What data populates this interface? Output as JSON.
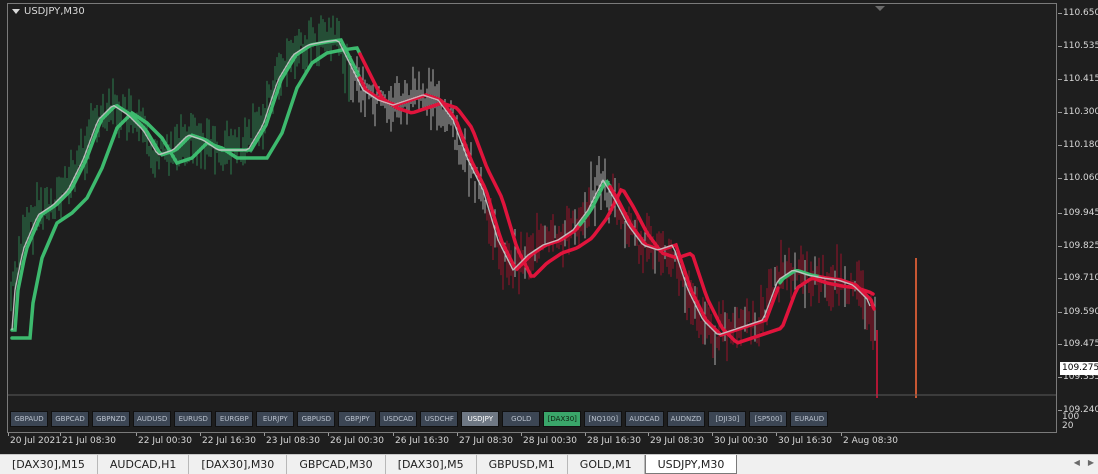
{
  "chart": {
    "title": "USDJPY,M30",
    "price_labels": [
      "110.650",
      "110.535",
      "110.415",
      "110.300",
      "110.180",
      "110.060",
      "109.945",
      "109.825",
      "109.710",
      "109.590",
      "109.475",
      "109.355",
      "109.240"
    ],
    "current_price": "109.275",
    "subwindow_labels": [
      "100",
      "20"
    ],
    "time_labels": [
      "20 Jul 2021",
      "21 Jul 08:30",
      "22 Jul 00:30",
      "22 Jul 16:30",
      "23 Jul 08:30",
      "26 Jul 00:30",
      "26 Jul 16:30",
      "27 Jul 08:30",
      "28 Jul 00:30",
      "28 Jul 16:30",
      "29 Jul 08:30",
      "30 Jul 00:30",
      "30 Jul 16:30",
      "2 Aug 08:30"
    ],
    "colors": {
      "bull": "#3dba6e",
      "bear": "#e0143c",
      "neutral": "#c8c8c8",
      "bg": "#1e1e1e",
      "spike": "#ff6a3a"
    }
  },
  "symbol_buttons": [
    {
      "label": "GBPAUD",
      "state": ""
    },
    {
      "label": "GBPCAD",
      "state": ""
    },
    {
      "label": "GBPNZD",
      "state": ""
    },
    {
      "label": "AUDUSD",
      "state": ""
    },
    {
      "label": "EURUSD",
      "state": ""
    },
    {
      "label": "EURGBP",
      "state": ""
    },
    {
      "label": "EURJPY",
      "state": ""
    },
    {
      "label": "GBPUSD",
      "state": ""
    },
    {
      "label": "GBPJPY",
      "state": ""
    },
    {
      "label": "USDCAD",
      "state": ""
    },
    {
      "label": "USDCHF",
      "state": ""
    },
    {
      "label": "USDJPY",
      "state": "active"
    },
    {
      "label": "GOLD",
      "state": ""
    },
    {
      "label": "[DAX30]",
      "state": "hl"
    },
    {
      "label": "[NQ100]",
      "state": ""
    },
    {
      "label": "AUDCAD",
      "state": ""
    },
    {
      "label": "AUDNZD",
      "state": ""
    },
    {
      "label": "[DJI30]",
      "state": ""
    },
    {
      "label": "[SP500]",
      "state": ""
    },
    {
      "label": "EURAUD",
      "state": ""
    }
  ],
  "tabs": [
    {
      "label": "[DAX30],M15",
      "active": false
    },
    {
      "label": "AUDCAD,H1",
      "active": false
    },
    {
      "label": "[DAX30],M30",
      "active": false
    },
    {
      "label": "GBPCAD,M30",
      "active": false
    },
    {
      "label": "[DAX30],M5",
      "active": false
    },
    {
      "label": "GBPUSD,M1",
      "active": false
    },
    {
      "label": "GOLD,M1",
      "active": false
    },
    {
      "label": "USDJPY,M30",
      "active": true
    }
  ]
}
